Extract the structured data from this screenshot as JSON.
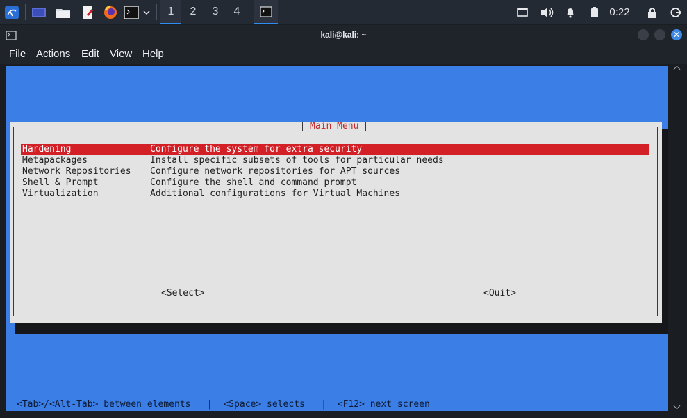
{
  "taskbar": {
    "workspaces": [
      "1",
      "2",
      "3",
      "4"
    ],
    "active_workspace": "1",
    "clock": "0:22"
  },
  "window": {
    "title": "kali@kali: ~",
    "close_glyph": "✕"
  },
  "menubar": {
    "items": [
      "File",
      "Actions",
      "Edit",
      "View",
      "Help"
    ]
  },
  "dialog": {
    "title": "Main Menu",
    "items": [
      {
        "tag": "Hardening",
        "description": "Configure the system for extra security",
        "selected": true
      },
      {
        "tag": "Metapackages",
        "description": "Install specific subsets of tools for particular needs",
        "selected": false
      },
      {
        "tag": "Network Repositories",
        "description": "Configure network repositories for APT sources",
        "selected": false
      },
      {
        "tag": "Shell & Prompt",
        "description": "Configure the shell and command prompt",
        "selected": false
      },
      {
        "tag": "Virtualization",
        "description": "Additional configurations for Virtual Machines",
        "selected": false
      }
    ],
    "select_button": "<Select>",
    "quit_button": "<Quit>"
  },
  "footer": {
    "help_text": "<Tab>/<Alt-Tab> between elements   |  <Space> selects   |  <F12> next screen"
  },
  "colors": {
    "terminal_bg": "#3b7ee6",
    "dialog_bg": "#e3e3e3",
    "selection": "#d32027",
    "accent": "#2f8cf0"
  }
}
